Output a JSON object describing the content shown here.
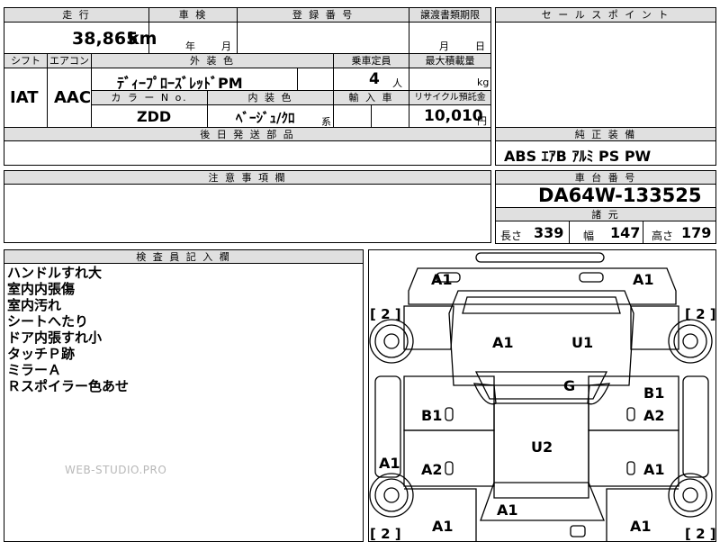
{
  "headers": {
    "mileage": "走 行",
    "inspection": "車 検",
    "registration": "登 録 番 号",
    "transfer_deadline": "譲渡書類期限",
    "sales_point": "セ ー ル ス ポ イ ン ト",
    "shift": "シフト",
    "aircon": "エアコン",
    "exterior_color": "外 装 色",
    "capacity": "乗車定員",
    "max_load": "最大積載量",
    "color_no": "カ ラ ー N o.",
    "interior_color": "内 装 色",
    "import": "輸 入 車",
    "recycle": "リサイクル預託金",
    "later_parts": "後 日 発 送 部 品",
    "equipment": "純 正 装 備",
    "caution": "注 意 事 項 欄",
    "chassis": "車 台 番 号",
    "specs": "諸 元",
    "inspector": "検 査 員 記 入 欄"
  },
  "mileage": {
    "value": "38,865",
    "unit": "km"
  },
  "inspection_date": {
    "year": "年",
    "month": "月"
  },
  "transfer_date": {
    "month": "月",
    "day": "日"
  },
  "shift": "IAT",
  "aircon": "AAC",
  "exterior_color": "ﾃﾞｨｰﾌﾟﾛｰｽﾞﾚｯﾄﾞPM",
  "capacity": {
    "value": "4",
    "unit": "人"
  },
  "max_load_unit": "kg",
  "color_no": "ZDD",
  "interior_color": {
    "value": "ﾍﾞｰｼﾞｭ/ｸﾛ",
    "suffix": "系"
  },
  "recycle": {
    "value": "10,010",
    "unit": "円"
  },
  "equipment": "ABS ｴｱB ｱﾙﾐ PS PW",
  "chassis_number": "DA64W-133525",
  "specs": {
    "length_label": "長さ",
    "length": "339",
    "width_label": "幅",
    "width": "147",
    "height_label": "高さ",
    "height": "179"
  },
  "inspector_notes": [
    "ハンドルすれ大",
    "室内内張傷",
    "室内汚れ",
    "シートへたり",
    "ドア内張すれ小",
    "タッチＰ跡",
    "ミラーＡ",
    "Ｒスポイラー色あせ"
  ],
  "watermark": "WEB-STUDIO.PRO",
  "diagram": {
    "marks": {
      "top_left": "A1",
      "top_right": "A1",
      "hood_left": "A1",
      "hood_right": "U1",
      "windshield": "G",
      "left_door_front": "B1",
      "right_door_front_b": "B1",
      "right_door_front_a": "A2",
      "roof": "U2",
      "left_rocker": "A1",
      "left_door_rear": "A2",
      "right_door_rear": "A1",
      "rear_center": "A1",
      "rear_left": "A1",
      "rear_right": "A1"
    },
    "tire_labels": {
      "front_left": "[ 2 ]",
      "front_right": "[ 2 ]",
      "rear_left": "[ 2 ]",
      "rear_right": "[ 2 ]"
    }
  }
}
